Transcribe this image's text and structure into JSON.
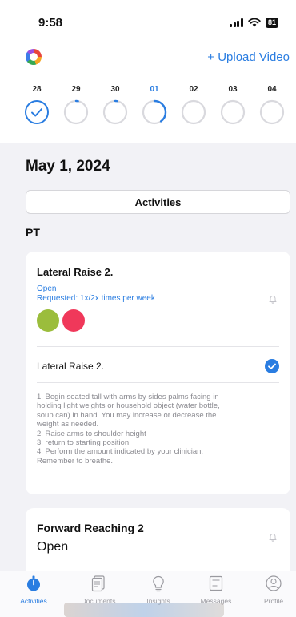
{
  "status_bar": {
    "time": "9:58",
    "battery": "81"
  },
  "header": {
    "upload_label": "+ Upload Video"
  },
  "days": [
    {
      "num": "28",
      "progress": 1.0,
      "completed": true,
      "highlight": false
    },
    {
      "num": "29",
      "progress": 0.03,
      "completed": false,
      "highlight": false
    },
    {
      "num": "30",
      "progress": 0.03,
      "completed": false,
      "highlight": false
    },
    {
      "num": "01",
      "progress": 0.4,
      "completed": false,
      "highlight": true
    },
    {
      "num": "02",
      "progress": 0,
      "completed": false,
      "highlight": false
    },
    {
      "num": "03",
      "progress": 0,
      "completed": false,
      "highlight": false
    },
    {
      "num": "04",
      "progress": 0,
      "completed": false,
      "highlight": false
    }
  ],
  "date_title": "May 1, 2024",
  "segment_label": "Activities",
  "section_label": "PT",
  "card1": {
    "title": "Lateral Raise 2.",
    "status": "Open",
    "requested": "Requested: 1x/2x times per week",
    "dot_colors": [
      "#9bbd3c",
      "#f0385a"
    ],
    "exercise_name": "Lateral Raise 2.",
    "instructions": [
      "1. Begin seated tall with arms by sides palms facing in",
      "holding light weights or household object (water bottle,",
      "soup can) in hand. You may increase or decrease the",
      "weight as needed.",
      "2. Raise arms to shoulder height",
      "3. return to starting position",
      "4.  Perform the amount indicated by your clinician.",
      "Remember to breathe."
    ]
  },
  "card2": {
    "title": "Forward Reaching 2",
    "status": "Open"
  },
  "tabs": [
    {
      "label": "Activities",
      "icon": "activities-icon",
      "active": true
    },
    {
      "label": "Documents",
      "icon": "documents-icon",
      "active": false
    },
    {
      "label": "Insights",
      "icon": "insights-icon",
      "active": false
    },
    {
      "label": "Messages",
      "icon": "messages-icon",
      "active": false
    },
    {
      "label": "Profile",
      "icon": "profile-icon",
      "active": false
    }
  ],
  "colors": {
    "accent": "#2a7de1",
    "ring_track": "#d9d9de"
  }
}
